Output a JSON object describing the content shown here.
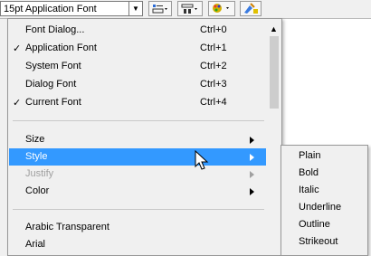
{
  "toolbar": {
    "font_combo_value": "15pt Application Font",
    "buttons": [
      "align-icon",
      "spacing-icon",
      "color-palette-icon",
      "paint-icon"
    ]
  },
  "menu": {
    "items": [
      {
        "label": "Font Dialog...",
        "shortcut": "Ctrl+0",
        "checked": false
      },
      {
        "label": "Application Font",
        "shortcut": "Ctrl+1",
        "checked": true
      },
      {
        "label": "System Font",
        "shortcut": "Ctrl+2",
        "checked": false
      },
      {
        "label": "Dialog Font",
        "shortcut": "Ctrl+3",
        "checked": false
      },
      {
        "label": "Current Font",
        "shortcut": "Ctrl+4",
        "checked": true
      },
      {
        "label": "Size",
        "submenu": true
      },
      {
        "label": "Style",
        "submenu": true,
        "highlighted": true
      },
      {
        "label": "Justify",
        "submenu": true,
        "disabled": true
      },
      {
        "label": "Color",
        "submenu": true
      },
      {
        "label": "Arabic Transparent"
      },
      {
        "label": "Arial"
      }
    ],
    "check_glyph": "✓"
  },
  "style_submenu": {
    "items": [
      "Plain",
      "Bold",
      "Italic",
      "Underline",
      "Outline",
      "Strikeout"
    ]
  },
  "colors": {
    "highlight": "#3399ff",
    "menu_bg": "#f0f0f0"
  }
}
